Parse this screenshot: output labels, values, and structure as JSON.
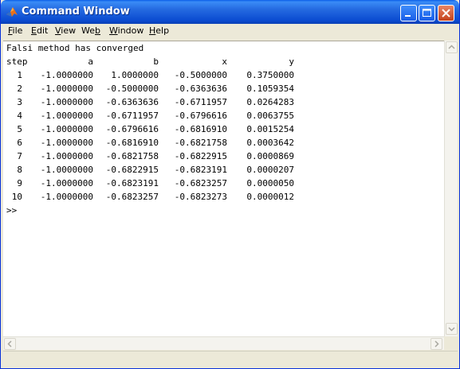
{
  "window": {
    "title": "Command Window",
    "icon": "matlab-logo-icon"
  },
  "title_buttons": {
    "minimize": "minimize-icon",
    "maximize": "maximize-icon",
    "close": "close-icon"
  },
  "menu": {
    "items": [
      {
        "prefix": "",
        "accel": "F",
        "rest": "ile"
      },
      {
        "prefix": "",
        "accel": "E",
        "rest": "dit"
      },
      {
        "prefix": "",
        "accel": "V",
        "rest": "iew"
      },
      {
        "prefix": "We",
        "accel": "b",
        "rest": ""
      },
      {
        "prefix": "",
        "accel": "W",
        "rest": "indow"
      },
      {
        "prefix": "",
        "accel": "H",
        "rest": "elp"
      }
    ]
  },
  "console": {
    "message": "Falsi method has converged",
    "headers": [
      "step",
      "a",
      "b",
      "x",
      "y"
    ],
    "rows": [
      [
        "1",
        "-1.0000000",
        "1.0000000",
        "-0.5000000",
        "0.3750000"
      ],
      [
        "2",
        "-1.0000000",
        "-0.5000000",
        "-0.6363636",
        "0.1059354"
      ],
      [
        "3",
        "-1.0000000",
        "-0.6363636",
        "-0.6711957",
        "0.0264283"
      ],
      [
        "4",
        "-1.0000000",
        "-0.6711957",
        "-0.6796616",
        "0.0063755"
      ],
      [
        "5",
        "-1.0000000",
        "-0.6796616",
        "-0.6816910",
        "0.0015254"
      ],
      [
        "6",
        "-1.0000000",
        "-0.6816910",
        "-0.6821758",
        "0.0003642"
      ],
      [
        "7",
        "-1.0000000",
        "-0.6821758",
        "-0.6822915",
        "0.0000869"
      ],
      [
        "8",
        "-1.0000000",
        "-0.6822915",
        "-0.6823191",
        "0.0000207"
      ],
      [
        "9",
        "-1.0000000",
        "-0.6823191",
        "-0.6823257",
        "0.0000050"
      ],
      [
        "10",
        "-1.0000000",
        "-0.6823257",
        "-0.6823273",
        "0.0000012"
      ]
    ],
    "prompt": ">>"
  },
  "colors": {
    "titlebar": "#2469e0",
    "chrome": "#ece9d8",
    "console_bg": "#ffffff"
  }
}
